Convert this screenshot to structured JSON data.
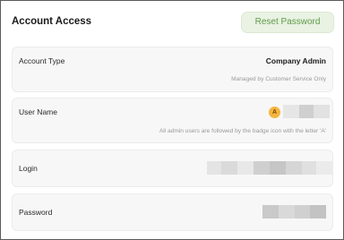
{
  "header": {
    "title": "Account Access",
    "reset_button": "Reset Password"
  },
  "account_type": {
    "label": "Account Type",
    "value": "Company Admin",
    "hint": "Managed by Customer Service Only"
  },
  "user_name": {
    "label": "User Name",
    "badge_letter": "A",
    "hint": "All admin users are followed by the badge icon with the letter 'A'"
  },
  "login": {
    "label": "Login"
  },
  "password": {
    "label": "Password"
  },
  "colors": {
    "accent_green": "#5f9a48",
    "button_bg": "#e9f2e3",
    "badge": "#f3b53e",
    "card_bg": "#f7f7f7"
  }
}
